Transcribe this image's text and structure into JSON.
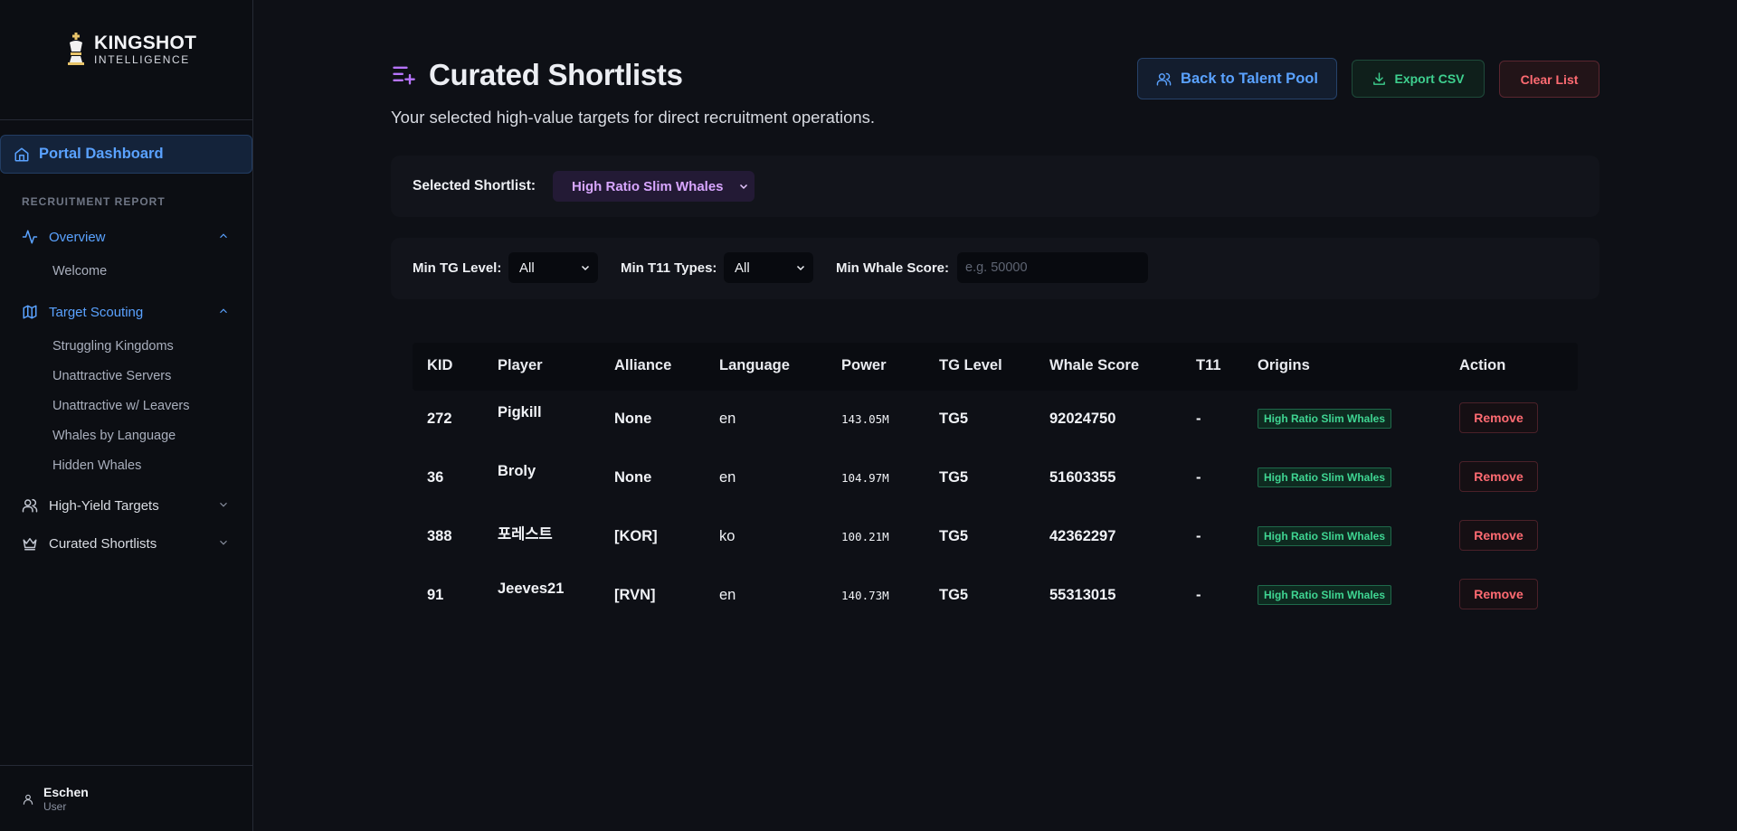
{
  "brand": {
    "line1": "KINGSHOT",
    "line2": "INTELLIGENCE"
  },
  "sidebar": {
    "portal_label": "Portal Dashboard",
    "section_label": "RECRUITMENT REPORT",
    "items": [
      {
        "label": "Overview",
        "icon": "activity-icon",
        "expanded": true
      },
      {
        "label": "Target Scouting",
        "icon": "map-icon",
        "expanded": true
      },
      {
        "label": "High-Yield Targets",
        "icon": "users-icon",
        "expanded": false
      },
      {
        "label": "Curated Shortlists",
        "icon": "crown-icon",
        "expanded": false
      }
    ],
    "overview_sub": [
      "Welcome"
    ],
    "scouting_sub": [
      "Struggling Kingdoms",
      "Unattractive Servers",
      "Unattractive w/ Leavers",
      "Whales by Language",
      "Hidden Whales"
    ],
    "user": {
      "name": "Eschen",
      "role": "User"
    }
  },
  "header": {
    "title": "Curated Shortlists",
    "subtitle": "Your selected high-value targets for direct recruitment operations.",
    "back_label": "Back to Talent Pool",
    "export_label": "Export CSV",
    "clear_label": "Clear List"
  },
  "shortlist": {
    "label": "Selected Shortlist:",
    "selected": "High Ratio Slim Whales"
  },
  "filters": {
    "tg_label": "Min TG Level:",
    "tg_value": "All",
    "t11_label": "Min T11 Types:",
    "t11_value": "All",
    "whale_label": "Min Whale Score:",
    "whale_placeholder": "e.g. 50000"
  },
  "table": {
    "headers": [
      "KID",
      "Player",
      "Alliance",
      "Language",
      "Power",
      "TG Level",
      "Whale Score",
      "T11",
      "Origins",
      "Action"
    ],
    "rows": [
      {
        "kid": "272",
        "player": "Pigkill",
        "alliance": "None",
        "language": "en",
        "power": "143.05M",
        "tg": "TG5",
        "whale": "92024750",
        "t11": "-",
        "origin": "High Ratio Slim Whales",
        "action": "Remove"
      },
      {
        "kid": "36",
        "player": "Broly",
        "alliance": "None",
        "language": "en",
        "power": "104.97M",
        "tg": "TG5",
        "whale": "51603355",
        "t11": "-",
        "origin": "High Ratio Slim Whales",
        "action": "Remove"
      },
      {
        "kid": "388",
        "player": "포레스트",
        "alliance": "[KOR]",
        "language": "ko",
        "power": "100.21M",
        "tg": "TG5",
        "whale": "42362297",
        "t11": "-",
        "origin": "High Ratio Slim Whales",
        "action": "Remove"
      },
      {
        "kid": "91",
        "player": "Jeeves21",
        "alliance": "[RVN]",
        "language": "en",
        "power": "140.73M",
        "tg": "TG5",
        "whale": "55313015",
        "t11": "-",
        "origin": "High Ratio Slim Whales",
        "action": "Remove"
      }
    ]
  },
  "colors": {
    "accent_blue": "#5aa2ff",
    "accent_purple": "#b774ff",
    "accent_green": "#3ed08f",
    "accent_red": "#ff6b72",
    "background": "#0e1016"
  }
}
